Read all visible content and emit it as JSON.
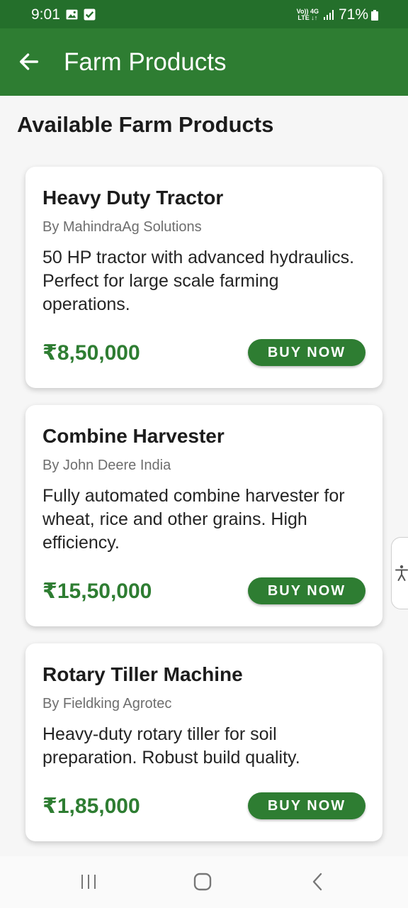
{
  "status_bar": {
    "time": "9:01",
    "network_top": "Vo)) 4G",
    "network_bottom": "LTE ↓↑",
    "battery": "71%",
    "icons": [
      "gallery-icon",
      "checkbox-icon",
      "signal-icon",
      "battery-icon"
    ]
  },
  "app_bar": {
    "title": "Farm Products",
    "back_icon": "arrow-left-icon"
  },
  "page": {
    "heading": "Available Farm Products"
  },
  "products": [
    {
      "name": "Heavy Duty Tractor",
      "seller": "By MahindraAg Solutions",
      "description": "50 HP tractor with advanced hydraulics. Perfect for large scale farming operations.",
      "price": "₹8,50,000",
      "button": "BUY NOW"
    },
    {
      "name": "Combine Harvester",
      "seller": "By John Deere India",
      "description": "Fully automated combine harvester for wheat, rice and other grains. High efficiency.",
      "price": "₹15,50,000",
      "button": "BUY NOW"
    },
    {
      "name": "Rotary Tiller Machine",
      "seller": "By Fieldking Agrotec",
      "description": "Heavy-duty rotary tiller for soil preparation. Robust build quality.",
      "price": "₹1,85,000",
      "button": "BUY NOW"
    }
  ],
  "accessibility_tab": {
    "icon": "accessibility-icon"
  },
  "nav_bar": {
    "icons": [
      "recents-icon",
      "home-icon",
      "back-icon"
    ]
  },
  "colors": {
    "primary": "#2e7d32",
    "status_bar": "#246f2b",
    "background": "#f6f6f6",
    "card": "#ffffff",
    "price": "#2e7d32"
  }
}
